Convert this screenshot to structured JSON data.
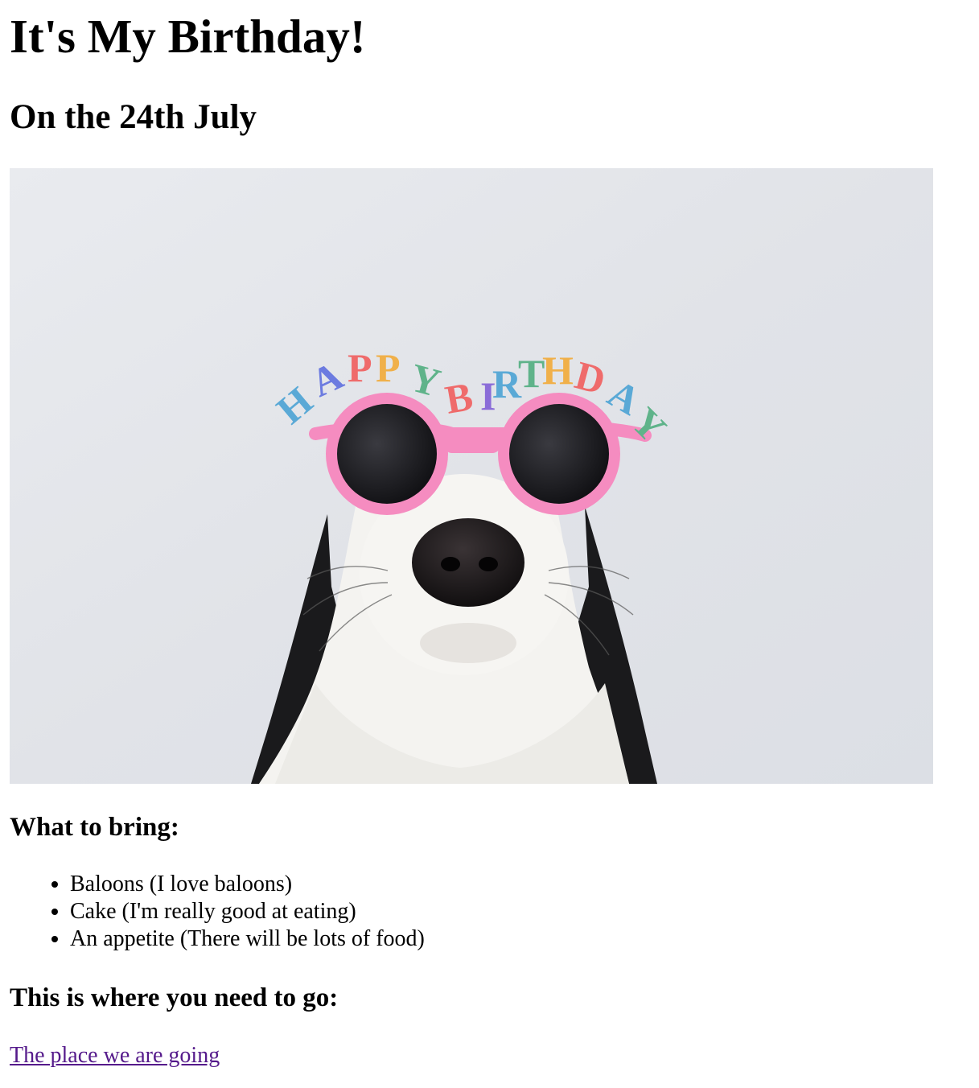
{
  "page": {
    "title": "It's My Birthday!",
    "subtitle": "On the 24th July"
  },
  "image": {
    "description": "dog-with-birthday-glasses",
    "glasses_text": "HAPPY BIRTHDAY",
    "colors": {
      "background": "#e3e5ea",
      "glasses_frame": "#f58cc0",
      "lens": "#1e1e22"
    }
  },
  "bring": {
    "heading": "What to bring:",
    "items": [
      "Baloons (I love baloons)",
      "Cake (I'm really good at eating)",
      "An appetite (There will be lots of food)"
    ]
  },
  "go": {
    "heading": "This is where you need to go:",
    "link_text": "The place we are going",
    "link_color": "#551a8b"
  }
}
